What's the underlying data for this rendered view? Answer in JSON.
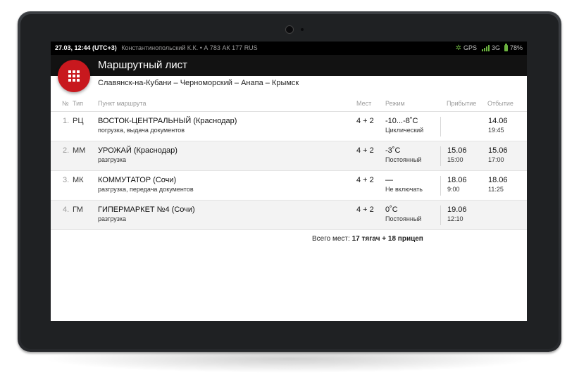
{
  "status": {
    "time": "27.03, 12:44 (UTC+3)",
    "driver": "Константинопольский К.К. • А 783 АК 177 RUS",
    "gps": "GPS",
    "network": "3G",
    "battery": "78%"
  },
  "header": {
    "title": "Маршрутный лист",
    "route": "Славянск-на-Кубани – Черноморский – Анапа – Крымск"
  },
  "table": {
    "columns": {
      "num": "№",
      "type": "Тип",
      "point": "Пункт маршрута",
      "seats": "Мест",
      "mode": "Режим",
      "arrival": "Прибытие",
      "departure": "Отбытие"
    },
    "rows": [
      {
        "num": "1.",
        "type": "РЦ",
        "name": "ВОСТОК-ЦЕНТРАЛЬНЫЙ (Краснодар)",
        "sub": "погрузка, выдача документов",
        "seats": "4 + 2",
        "temp": "-10...-8˚C",
        "mode": "Циклический",
        "arr_date": "",
        "arr_time": "",
        "dep_date": "14.06",
        "dep_time": "19:45"
      },
      {
        "num": "2.",
        "type": "ММ",
        "name": "УРОЖАЙ (Краснодар)",
        "sub": "разгрузка",
        "seats": "4 + 2",
        "temp": "-3˚C",
        "mode": "Постоянный",
        "arr_date": "15.06",
        "arr_time": "15:00",
        "dep_date": "15.06",
        "dep_time": "17:00"
      },
      {
        "num": "3.",
        "type": "МК",
        "name": "КОММУТАТОР (Сочи)",
        "sub": "разгрузка, передача документов",
        "seats": "4 + 2",
        "temp": "—",
        "mode": "Не включать",
        "arr_date": "18.06",
        "arr_time": "9:00",
        "dep_date": "18.06",
        "dep_time": "11:25"
      },
      {
        "num": "4.",
        "type": "ГМ",
        "name": "ГИПЕРМАРКЕТ №4 (Сочи)",
        "sub": "разгрузка",
        "seats": "4 + 2",
        "temp": "0˚C",
        "mode": "Постоянный",
        "arr_date": "19.06",
        "arr_time": "12:10",
        "dep_date": "",
        "dep_time": ""
      }
    ]
  },
  "total": {
    "label": "Всего мест:",
    "value": "17 тягач + 18 прицеп"
  }
}
